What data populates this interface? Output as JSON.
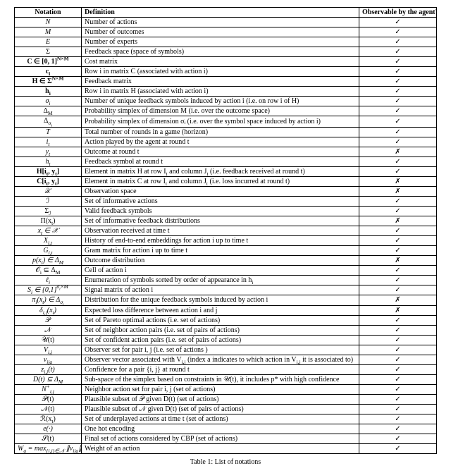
{
  "header": {
    "notation": "Notation",
    "definition": "Definition",
    "observable": "Observable by the agent?"
  },
  "rows": [
    {
      "notation": "N",
      "nclass": "it",
      "def": "Number of actions",
      "obs": "check"
    },
    {
      "notation": "M",
      "nclass": "it",
      "def": "Number of outcomes",
      "obs": "check"
    },
    {
      "notation": "E",
      "nclass": "it",
      "def": "Number of experts",
      "obs": "check"
    },
    {
      "notation": "Σ",
      "nclass": "",
      "def": "Feedback space (space of symbols)",
      "obs": "check"
    },
    {
      "notation": "C ∈ [0, 1]<sup>N×M</sup>",
      "nclass": "bf",
      "def": "Cost matrix",
      "obs": "check"
    },
    {
      "notation": "c<sub>i</sub>",
      "nclass": "bf",
      "def": "Row i in matrix C (associated with action i)",
      "obs": "check"
    },
    {
      "notation": "H ∈ Σ<sup>N×M</sup>",
      "nclass": "bf",
      "def": "Feedback matrix",
      "obs": "check"
    },
    {
      "notation": "h<sub>i</sub>",
      "nclass": "bf",
      "def": "Row i in matrix H (associated with action i)",
      "obs": "check"
    },
    {
      "notation": "σ<sub>i</sub>",
      "nclass": "it",
      "def": "Number of unique feedback symbols induced by action i (i.e. on row i of H)",
      "obs": "check"
    },
    {
      "notation": "Δ<sub>M</sub>",
      "nclass": "",
      "def": "Probability simplex of dimension M (i.e. over the outcome space)",
      "obs": "check"
    },
    {
      "notation": "Δ<sub>σ<sub>i</sub></sub>",
      "nclass": "",
      "def": "Probability simplex of dimension σᵢ (i.e. over the symbol space induced by action i)",
      "obs": "check"
    },
    {
      "notation": "T",
      "nclass": "it",
      "def": "Total number of rounds in a game (horizon)",
      "obs": "check"
    },
    {
      "notation": "i<sub>t</sub>",
      "nclass": "it",
      "def": "Action played by the agent at round t",
      "obs": "check"
    },
    {
      "notation": "y<sub>t</sub>",
      "nclass": "it",
      "def": "Outcome at round t",
      "obs": "cross"
    },
    {
      "notation": "h<sub>t</sub>",
      "nclass": "it",
      "def": "Feedback symbol at round t",
      "obs": "check"
    },
    {
      "notation": "H[i<sub>t</sub>, y<sub>t</sub>]",
      "nclass": "bf",
      "def": "Element in matrix H at row I<sub>t</sub> and column J<sub>t</sub> (i.e. feedback received at round t)",
      "obs": "check"
    },
    {
      "notation": "C[i<sub>t</sub>, y<sub>t</sub>]",
      "nclass": "bf",
      "def": "Element in matrix C at row I<sub>t</sub> and column J<sub>t</sub> (i.e. loss incurred at round t)",
      "obs": "cross"
    },
    {
      "notation": "𝒳",
      "nclass": "",
      "def": "Observation space",
      "obs": "cross"
    },
    {
      "notation": "ℐ",
      "nclass": "",
      "def": "Set of informative actions",
      "obs": "check"
    },
    {
      "notation": "Σ<sub>ℐ</sub>",
      "nclass": "",
      "def": "Valid feedback symbols",
      "obs": "check"
    },
    {
      "notation": "Π(x<sub>t</sub>)",
      "nclass": "",
      "def": "Set of informative feedback distributions",
      "obs": "cross"
    },
    {
      "notation": "x<sub>t</sub> ∈ 𝒳",
      "nclass": "it",
      "def": "Observation received at time t",
      "obs": "check"
    },
    {
      "notation": "X<sub>i,t</sub>",
      "nclass": "it",
      "def": "History of end-to-end embeddings for action i up to time t",
      "obs": "check"
    },
    {
      "notation": "G<sub>i,t</sub>",
      "nclass": "it",
      "def": "Gram matrix for action i up to time t",
      "obs": "check"
    },
    {
      "notation": "p(x<sub>t</sub>) ∈ Δ<sub>M</sub>",
      "nclass": "it",
      "def": "Outcome distribution",
      "obs": "cross"
    },
    {
      "notation": "𝒪<sub>i</sub> ⊆ Δ<sub>M</sub>",
      "nclass": "",
      "def": "Cell of action i",
      "obs": "check"
    },
    {
      "notation": "ℓ<sub>i</sub>",
      "nclass": "it",
      "def": "Enumeration of symbols sorted by order of appearance in h<sub>i</sub>",
      "obs": "check"
    },
    {
      "notation": "S<sub>i</sub> ∈ {0,1}<sup>σ<sub>i</sub>×M</sup>",
      "nclass": "it",
      "def": "Signal matrix of action i",
      "obs": "check"
    },
    {
      "notation": "π<sub>i</sub>(x<sub>t</sub>) ∈ Δ<sub>σ<sub>i</sub></sub>",
      "nclass": "it",
      "def": "Distribution for the unique feedback symbols induced by action i",
      "obs": "cross"
    },
    {
      "notation": "δ<sub>i,j</sub>(x<sub>t</sub>)",
      "nclass": "it",
      "def": "Expected loss difference between action i and j",
      "obs": "cross"
    },
    {
      "notation": "𝒫",
      "nclass": "",
      "def": "Set of Pareto optimal actions (i.e. set of actions)",
      "obs": "check"
    },
    {
      "notation": "𝒩",
      "nclass": "",
      "def": "Set of neighbor action pairs (i.e. set of pairs of actions)",
      "obs": "check"
    },
    {
      "notation": "𝒰(t)",
      "nclass": "",
      "def": "Set of confident action pairs (i.e. set of pairs of actions)",
      "obs": "check"
    },
    {
      "notation": "V<sub>i,j</sub>",
      "nclass": "it",
      "def": "Observer set for pair i, j (i.e. set of actions )",
      "obs": "check"
    },
    {
      "notation": "v<sub>ija</sub>",
      "nclass": "it",
      "def": "Observer vector associated with V<sub>i,j</sub> (index a indicates to which action in V<sub>i,j</sub> it is associated to)",
      "obs": "check"
    },
    {
      "notation": "z<sub>i,j</sub>(t)",
      "nclass": "it",
      "def": "Confidence for a pair {i, j} at round t",
      "obs": "check"
    },
    {
      "notation": "D(t) ⊆ Δ<sub>M</sub>",
      "nclass": "it",
      "def": "Sub-space of the simplex based on constraints in 𝒰(t), it includes p* with high confidence",
      "obs": "check"
    },
    {
      "notation": "N<sup>+</sup><sub>i,j</sub>",
      "nclass": "it",
      "def": "Neighbor action set for pair i, j (set of actions)",
      "obs": "check"
    },
    {
      "notation": "𝒫(t)",
      "nclass": "",
      "def": "Plausible subset of 𝒫 given D(t) (set of actions)",
      "obs": "check"
    },
    {
      "notation": "𝒩(t)",
      "nclass": "",
      "def": "Plausible subset of 𝒩 given D(t) (set of pairs of actions)",
      "obs": "check"
    },
    {
      "notation": "ℛ(x<sub>t</sub>)",
      "nclass": "",
      "def": "Set of underplayed actions at time t (set of actions)",
      "obs": "check"
    },
    {
      "notation": "e(·)",
      "nclass": "it",
      "def": "One hot encoding",
      "obs": "check"
    },
    {
      "notation": "𝒮(t)",
      "nclass": "",
      "def": "Final set of actions considered by CBP (set of actions)",
      "obs": "check"
    },
    {
      "notation": "W<sub>a</sub> = max<sub>{i,j}∈𝒩</sub> ∥v<sub>ija</sub>∥<sub>∞</sub>",
      "nclass": "it",
      "def": "Weight of an action",
      "obs": "check"
    }
  ],
  "caption": "Table 1: List of notations"
}
